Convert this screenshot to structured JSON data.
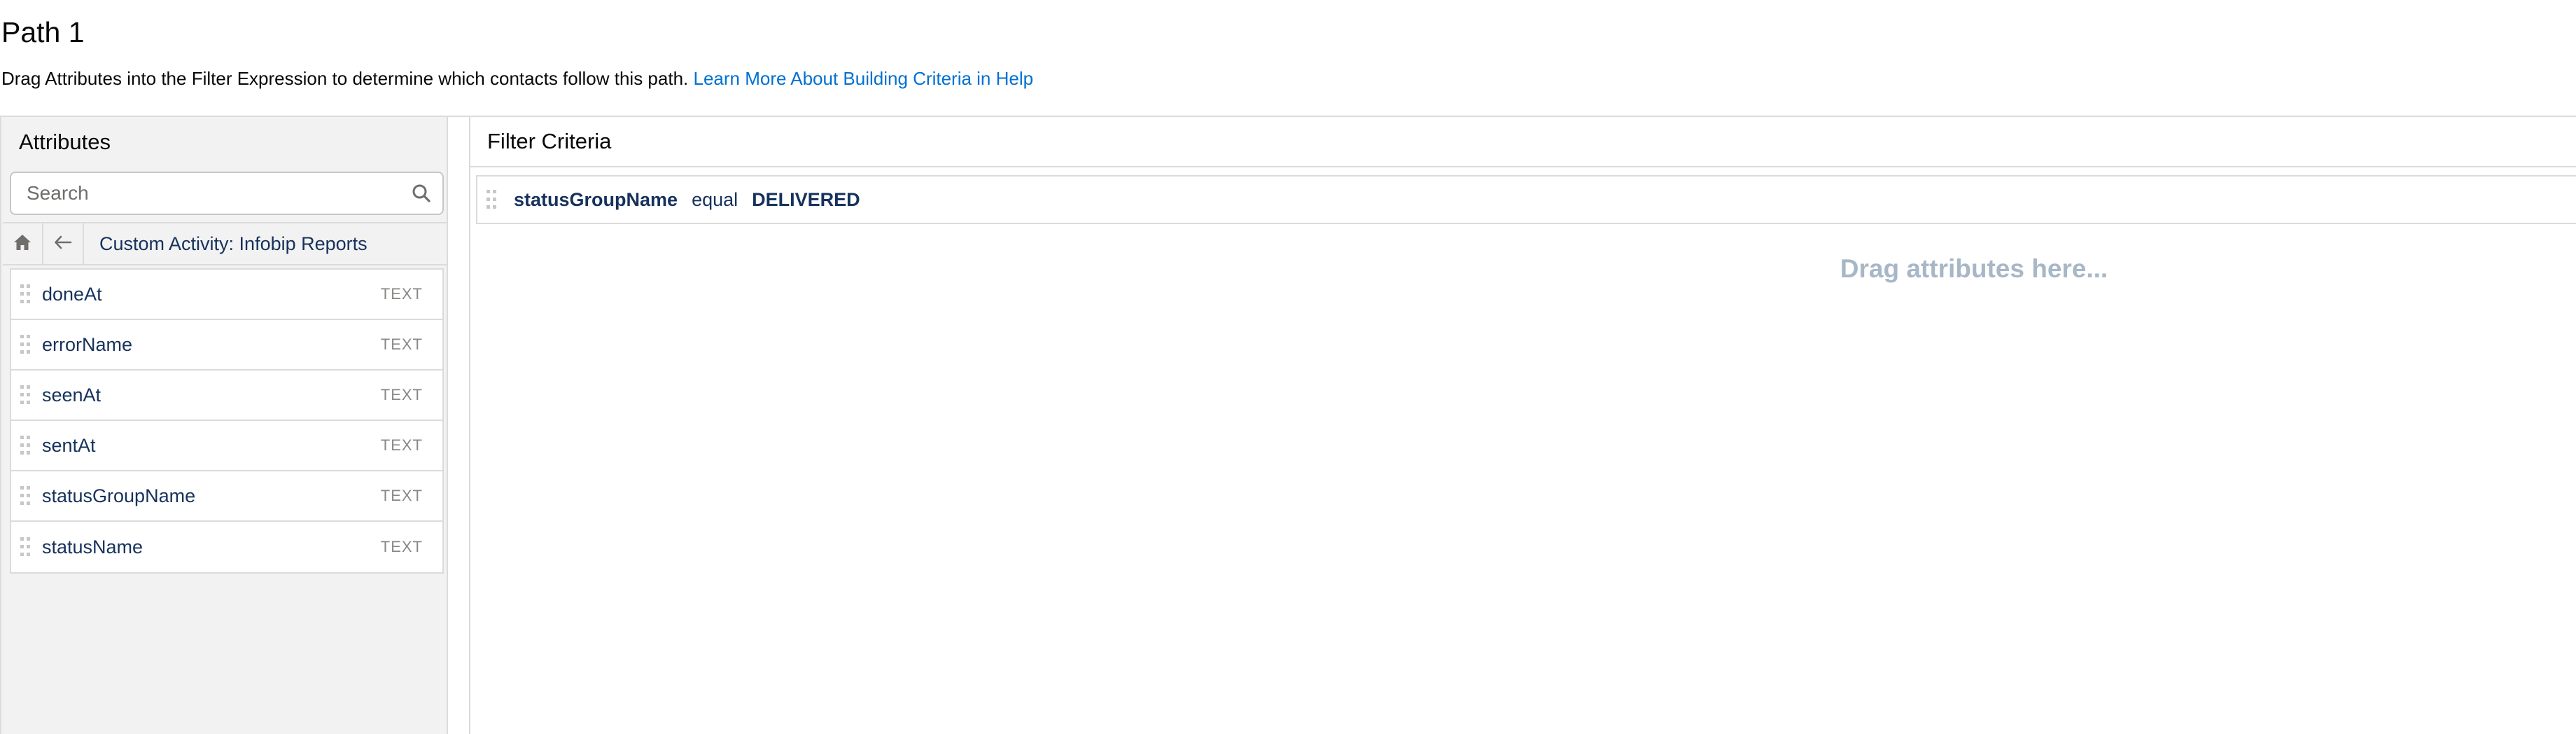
{
  "page": {
    "title": "Path 1",
    "description": "Drag Attributes into the Filter Expression to determine which contacts follow this path.",
    "help_link": "Learn More About Building Criteria in Help"
  },
  "attributes_panel": {
    "header": "Attributes",
    "search": {
      "placeholder": "Search",
      "value": ""
    },
    "breadcrumb": "Custom Activity: Infobip Reports",
    "items": [
      {
        "name": "doneAt",
        "type": "TEXT"
      },
      {
        "name": "errorName",
        "type": "TEXT"
      },
      {
        "name": "seenAt",
        "type": "TEXT"
      },
      {
        "name": "sentAt",
        "type": "TEXT"
      },
      {
        "name": "statusGroupName",
        "type": "TEXT"
      },
      {
        "name": "statusName",
        "type": "TEXT"
      }
    ]
  },
  "filter_panel": {
    "header": "Filter Criteria",
    "criteria": [
      {
        "field": "statusGroupName",
        "operator": "equal",
        "value": "DELIVERED"
      }
    ],
    "drop_hint": "Drag attributes here..."
  },
  "icons": {
    "search": "search-icon",
    "home": "home-icon",
    "back": "back-arrow-icon",
    "grip": "drag-handle-icon"
  },
  "colors": {
    "link": "#0070d2",
    "text_dark": "#16325c",
    "panel_bg": "#f3f2f2",
    "border": "#dddbda",
    "hint": "#a8b7c7"
  }
}
